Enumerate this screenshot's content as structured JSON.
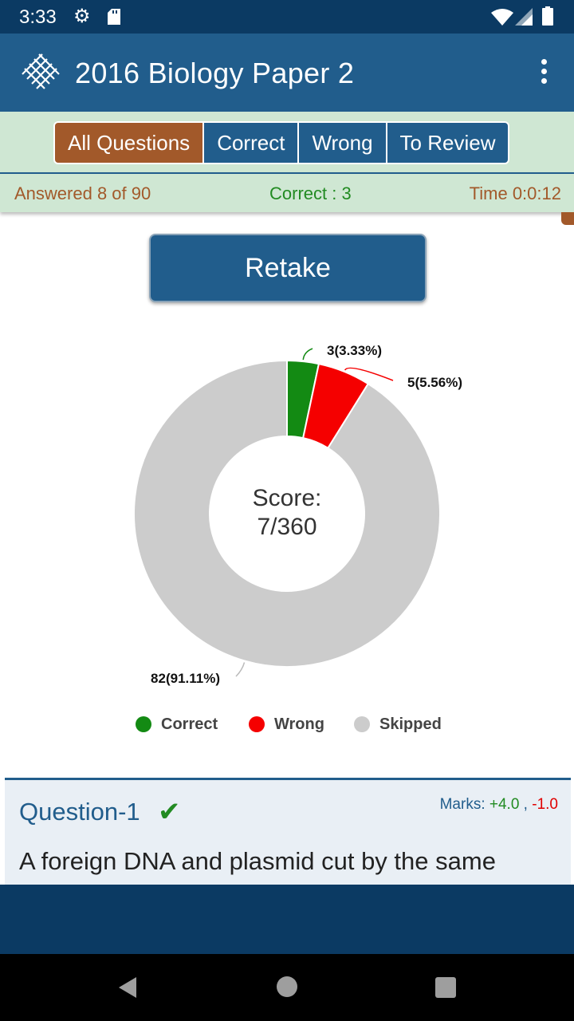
{
  "status_bar": {
    "time": "3:33",
    "icons": [
      "gear-icon",
      "sd-card-icon",
      "wifi-icon",
      "signal-icon",
      "battery-icon"
    ]
  },
  "app_bar": {
    "title": "2016 Biology Paper 2",
    "logo_icon": "crosshatch-logo-icon",
    "menu_icon": "more-vert-icon"
  },
  "filter_tabs": [
    {
      "label": "All Questions",
      "active": true
    },
    {
      "label": "Correct",
      "active": false
    },
    {
      "label": "Wrong",
      "active": false
    },
    {
      "label": "To Review",
      "active": false
    }
  ],
  "summary": {
    "answered": "Answered 8 of 90",
    "correct": "Correct : 3",
    "time": "Time 0:0:12"
  },
  "retake_label": "Retake",
  "score": {
    "line1": "Score:",
    "line2": "7/360"
  },
  "chart_data": {
    "type": "pie",
    "donut": true,
    "slices": [
      {
        "name": "Correct",
        "value": 3,
        "label": "3(3.33%)",
        "color": "#138a13"
      },
      {
        "name": "Wrong",
        "value": 5,
        "label": "5(5.56%)",
        "color": "#f50000"
      },
      {
        "name": "Skipped",
        "value": 82,
        "label": "82(91.11%)",
        "color": "#cccccc"
      }
    ],
    "legend_position": "bottom"
  },
  "question": {
    "title": "Question-1",
    "status_icon": "checkmark-icon",
    "marks_prefix": "Marks: ",
    "marks_positive": "+4.0",
    "marks_sep": " , ",
    "marks_negative": "-1.0",
    "text": "A foreign DNA and plasmid cut by the same"
  },
  "colors": {
    "primary": "#215d8c",
    "dark": "#0b3a63",
    "accent": "#a2592a",
    "bar_bg": "#cfe7d3",
    "correct": "#228b22",
    "wrong": "#e00000"
  },
  "nav_bar": [
    "back-icon",
    "home-icon",
    "recent-apps-icon"
  ]
}
